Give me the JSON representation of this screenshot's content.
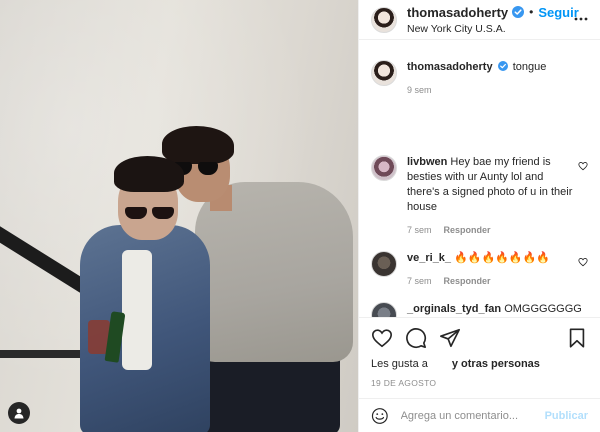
{
  "header": {
    "username": "thomasadoherty",
    "separator": "•",
    "follow_label": "Seguir",
    "location": "New York City U.S.A."
  },
  "caption": {
    "username": "thomasadoherty",
    "text": "tongue",
    "time": "9 sem"
  },
  "comments": [
    {
      "username": "livbwen",
      "text": "Hey bae my friend is besties with ur Aunty lol and there's a signed photo of u in their house",
      "time": "7 sem",
      "reply_label": "Responder"
    },
    {
      "username": "ve_ri_k_",
      "text": "🔥🔥🔥🔥🔥🔥🔥",
      "time": "7 sem",
      "reply_label": "Responder"
    },
    {
      "username": "_orginals_tyd_fan",
      "text": "OMGGGGGGG"
    }
  ],
  "likes": {
    "prefix": "Les gusta a",
    "others": "y otras personas"
  },
  "date": "19 de agosto",
  "comment_box": {
    "placeholder": "Agrega un comentario...",
    "publish_label": "Publicar"
  },
  "colors": {
    "accent": "#0095f6",
    "verified": "#3897f0",
    "publish_disabled": "#b2dffc"
  },
  "icons": {
    "like": "heart-icon",
    "comment": "comment-icon",
    "share": "share-icon",
    "save": "bookmark-icon",
    "emoji": "emoji-icon",
    "more": "more-icon",
    "tags": "user-tag-icon"
  }
}
